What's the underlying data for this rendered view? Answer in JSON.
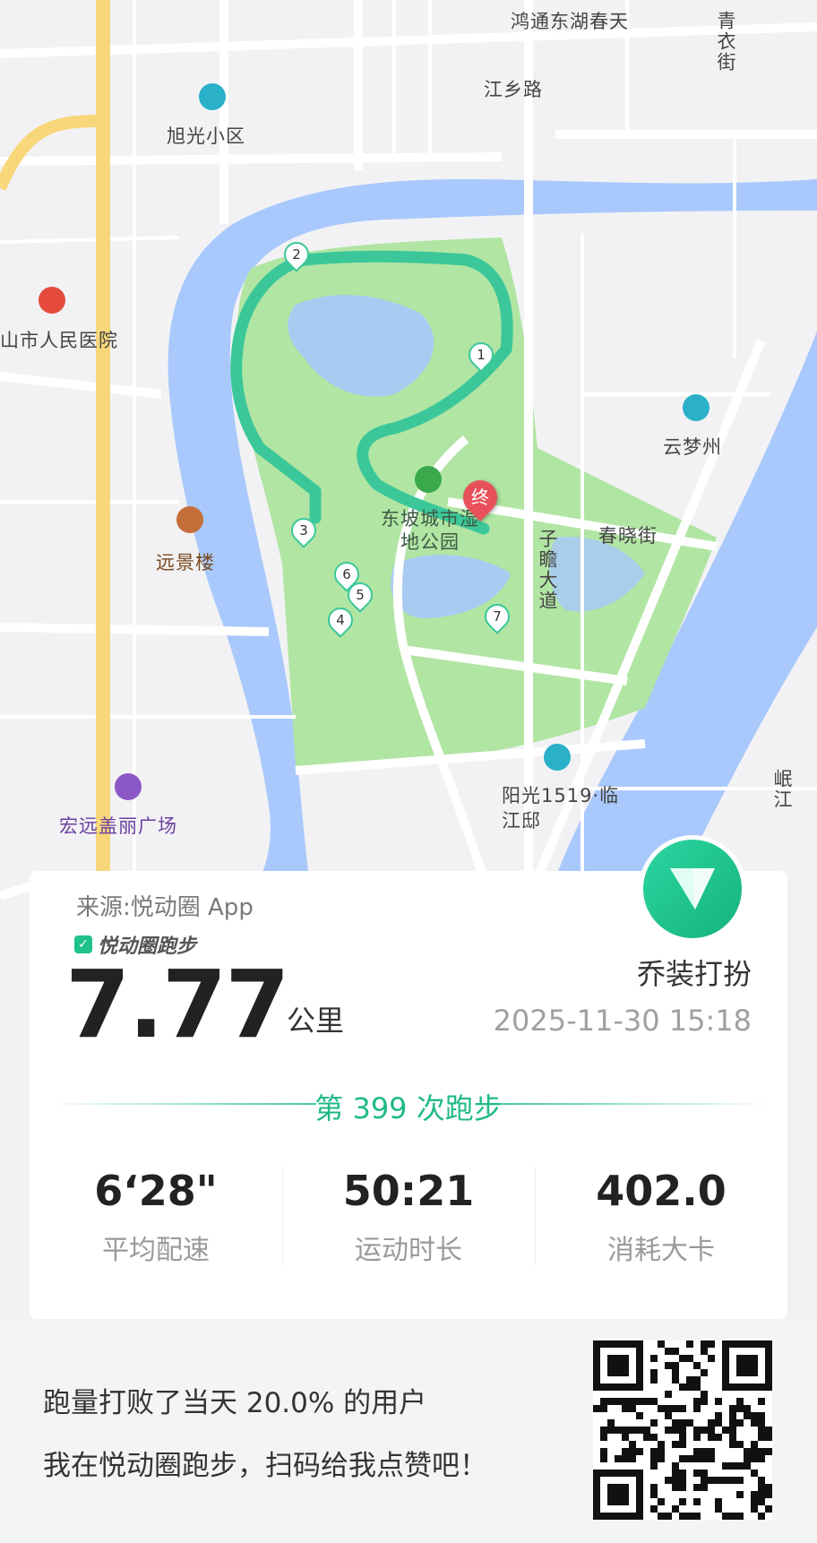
{
  "map": {
    "labels": {
      "hongtong": "鸿通东湖春天",
      "qingyijie": "青衣街",
      "jiangxianglu": "江乡路",
      "xuguang": "旭光小区",
      "hospital": "山市人民医院",
      "yunmengzhou": "云梦州",
      "chunxiaojie": "春晓街",
      "park": "东坡城市湿地公园",
      "zizhandadao": "子瞻大道",
      "yuanjinglou": "远景楼",
      "yangguang": "阳光1519·临江邸",
      "minjiang": "岷江",
      "hongyuan": "宏远盖丽广场"
    },
    "markers": [
      "1",
      "2",
      "3",
      "4",
      "5",
      "6",
      "7"
    ],
    "end_marker": "终",
    "colors": {
      "water": "#a9c8fb",
      "park": "#b1e5a3",
      "land": "#f2f2f5",
      "road": "#ffffff",
      "route": "#3cc79a"
    }
  },
  "card": {
    "source": "来源:悦动圈 App",
    "brand": "悦动圈跑步",
    "distance": "7.77",
    "unit": "公里",
    "username": "乔装打扮",
    "datetime": "2025-11-30 15:18",
    "run_count": "第 399 次跑步",
    "stats": [
      {
        "value": "6‘28\"",
        "label": "平均配速"
      },
      {
        "value": "50:21",
        "label": "运动时长"
      },
      {
        "value": "402.0",
        "label": "消耗大卡"
      }
    ],
    "accent": "#20b98a"
  },
  "footer": {
    "line1": "跑量打败了当天 20.0% 的用户",
    "line2": "我在悦动圈跑步，扫码给我点赞吧！"
  }
}
